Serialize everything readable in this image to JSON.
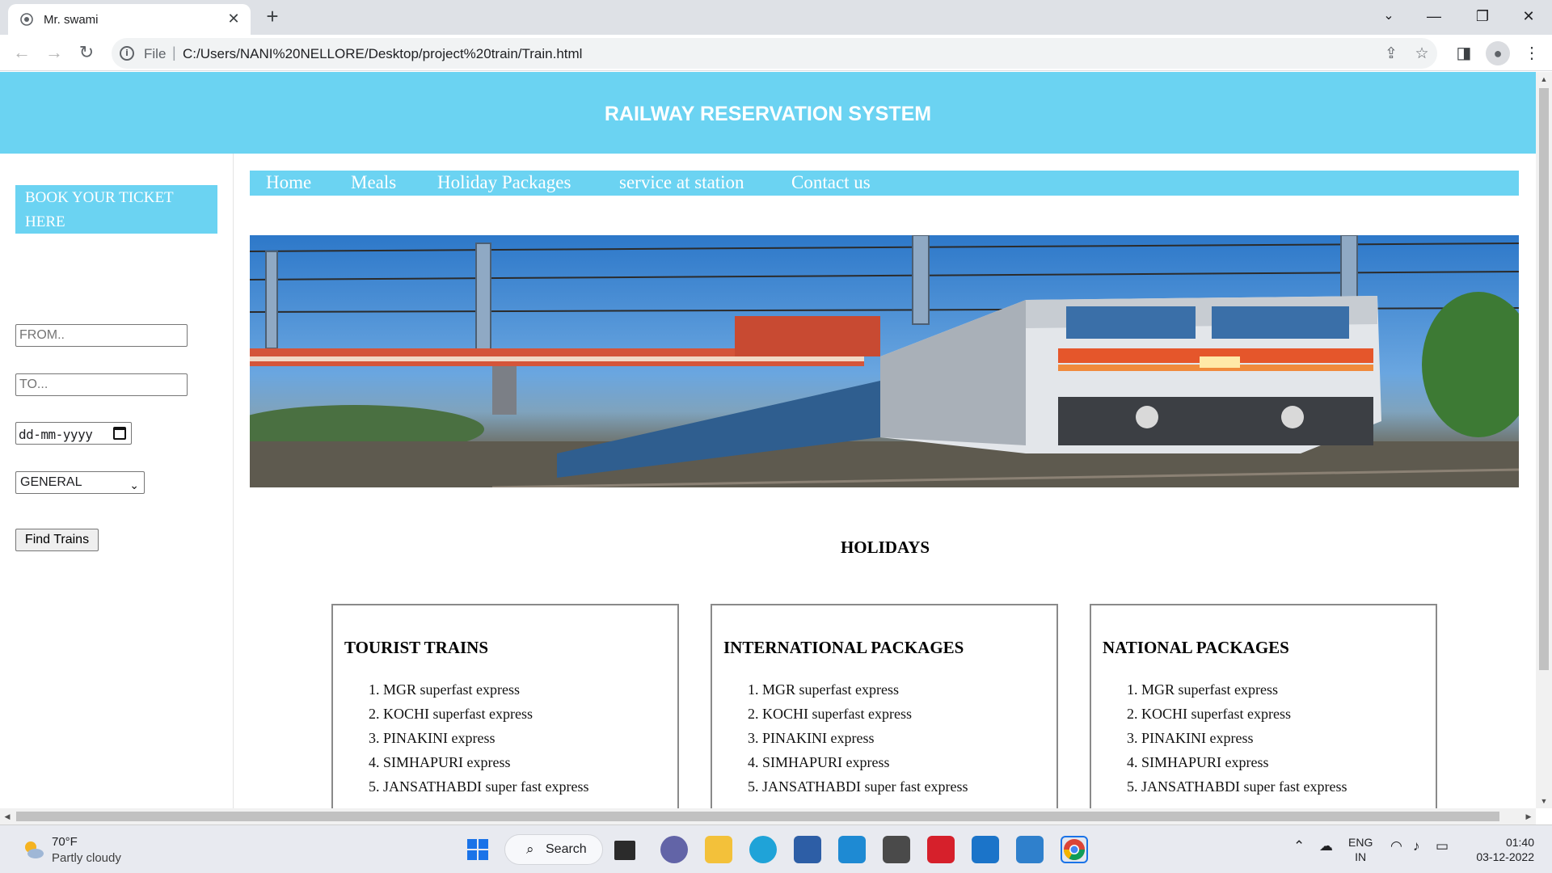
{
  "browser": {
    "tab_title": "Mr. swami",
    "tab_close": "✕",
    "new_tab": "+",
    "tab_search": "⌄",
    "minimize": "—",
    "maximize": "❐",
    "close": "✕",
    "scheme_label": "File",
    "separator": "|",
    "url": "C:/Users/NANI%20NELLORE/Desktop/project%20train/Train.html"
  },
  "site": {
    "title": "RAILWAY RESERVATION SYSTEM",
    "header_color": "#6bd3f2"
  },
  "booking": {
    "heading": "BOOK YOUR TICKET HERE",
    "from_placeholder": "FROM..",
    "to_placeholder": "TO...",
    "date_placeholder": "dd-mm-yyyy",
    "class_value": "GENERAL",
    "submit_label": "Find Trains"
  },
  "nav": {
    "items": [
      "Home",
      "Meals",
      "Holiday Packages",
      "service at station",
      "Contact us"
    ]
  },
  "holidays": {
    "title": "HOLIDAYS",
    "cards": [
      {
        "title": "TOURIST TRAINS",
        "items": [
          "1. MGR superfast express",
          "2. KOCHI superfast express",
          "3. PINAKINI express",
          "4. SIMHAPURI express",
          "5. JANSATHABDI super fast express"
        ]
      },
      {
        "title": "INTERNATIONAL PACKAGES",
        "items": [
          "1. MGR superfast express",
          "2. KOCHI superfast express",
          "3. PINAKINI express",
          "4. SIMHAPURI express",
          "5. JANSATHABDI super fast express"
        ]
      },
      {
        "title": "NATIONAL PACKAGES",
        "items": [
          "1. MGR superfast express",
          "2. KOCHI superfast express",
          "3. PINAKINI express",
          "4. SIMHAPURI express",
          "5. JANSATHABDI super fast express"
        ]
      }
    ]
  },
  "taskbar": {
    "temperature": "70°F",
    "weather": "Partly cloudy",
    "search_label": "Search",
    "lang_1": "ENG",
    "lang_2": "IN",
    "time": "01:40",
    "date": "03-12-2022"
  }
}
